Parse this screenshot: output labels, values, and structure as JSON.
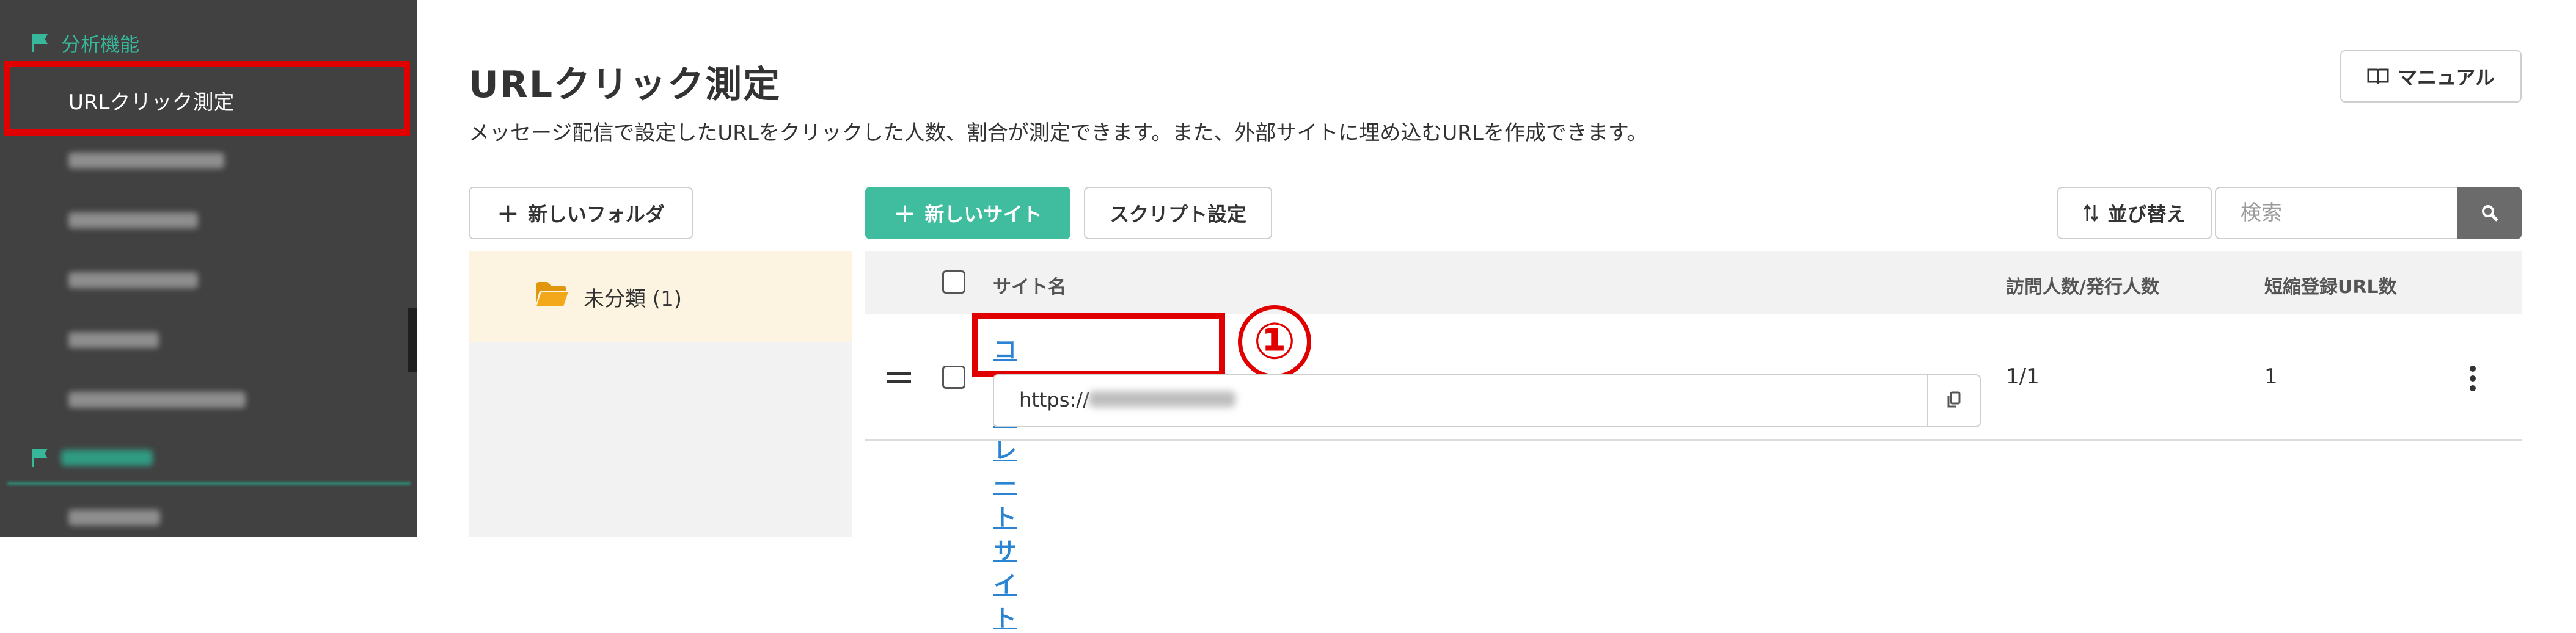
{
  "sidebar": {
    "group_label": "分析機能",
    "selected_item": "URLクリック測定"
  },
  "page": {
    "title": "URLクリック測定",
    "description": "メッセージ配信で設定したURLをクリックした人数、割合が測定できます。また、外部サイトに埋め込むURLを作成できます。",
    "manual_label": "マニュアル"
  },
  "toolbar": {
    "new_folder_label": "新しいフォルダ",
    "new_site_label": "新しいサイト",
    "script_label": "スクリプト設定",
    "sort_label": "並び替え",
    "search_placeholder": "検索"
  },
  "folders": [
    {
      "label": "未分類 (1)"
    }
  ],
  "table": {
    "columns": [
      "サイト名",
      "訪問人数/発行人数",
      "短縮登録URL数"
    ],
    "rows": [
      {
        "site_name": "コーポレートサイト",
        "url_prefix": "https://",
        "visits": "1/1",
        "short_urls": "1"
      }
    ]
  },
  "annotation": {
    "marker": "①"
  },
  "colors": {
    "sidebar_bg": "#414141",
    "accent_green": "#3fbd9e",
    "highlight_red": "#e00000",
    "link_blue": "#2a84d2"
  }
}
